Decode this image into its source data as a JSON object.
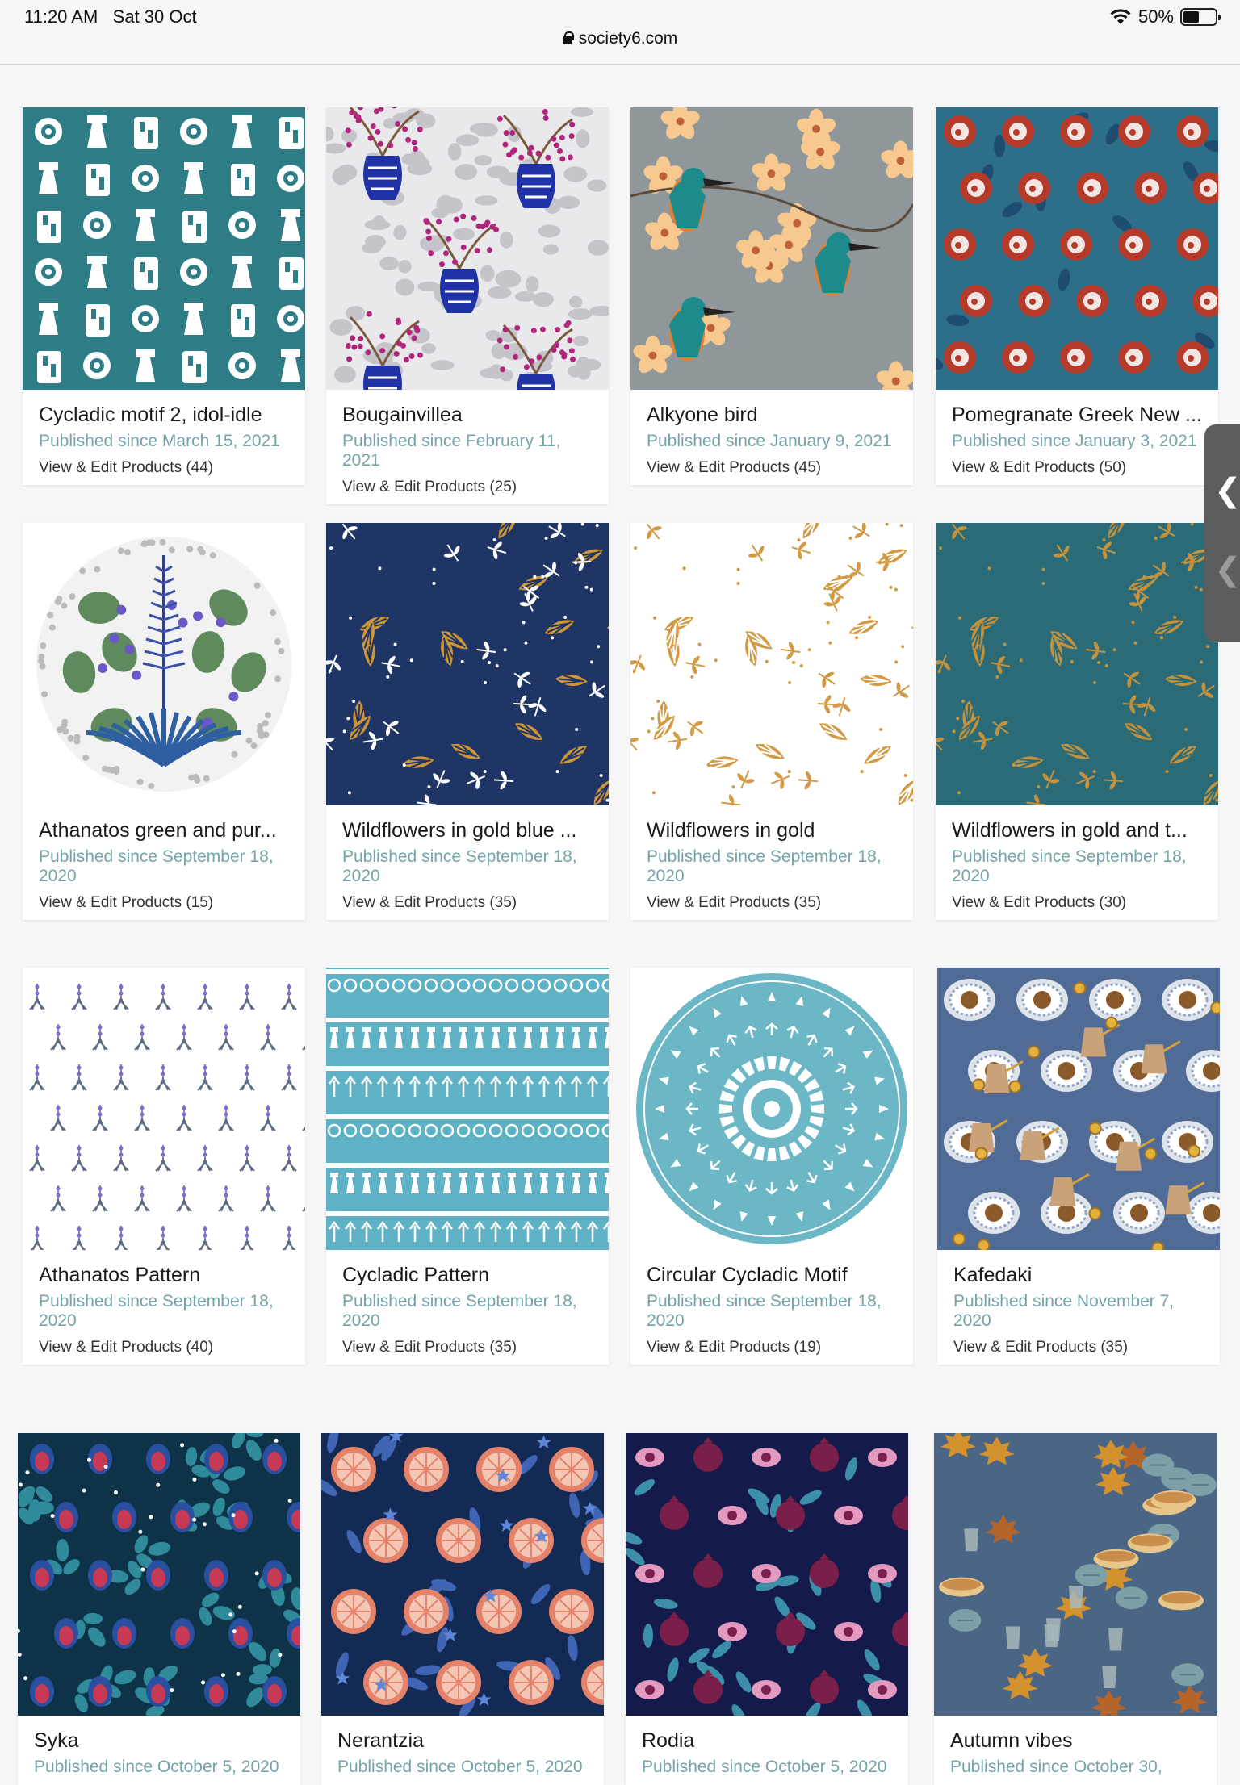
{
  "status": {
    "time": "11:20 AM",
    "date": "Sat 30 Oct",
    "battery": "50%",
    "battery_level": 0.5
  },
  "browser": {
    "url": "society6.com"
  },
  "colors": {
    "published": "#74a4a8"
  },
  "cards": [
    {
      "title": "Cycladic motif 2, idol-idle",
      "published": "Published since March 15, 2021",
      "edit": "View & Edit Products (44)",
      "art": "idols-teal"
    },
    {
      "title": "Bougainvillea",
      "published": "Published since February 11, 2021",
      "edit": "View & Edit Products (25)",
      "art": "bougainvillea"
    },
    {
      "title": "Alkyone bird",
      "published": "Published since January 9, 2021",
      "edit": "View & Edit Products (45)",
      "art": "kingfisher"
    },
    {
      "title": "Pomegranate Greek New ...",
      "published": "Published since January 3, 2021",
      "edit": "View & Edit Products (50)",
      "art": "pomegranate-teal"
    },
    {
      "title": "Athanatos green and pur...",
      "published": "Published since September 18, 2020",
      "edit": "View & Edit Products (15)",
      "art": "agave-circle"
    },
    {
      "title": "Wildflowers in gold blue ...",
      "published": "Published since September 18, 2020",
      "edit": "View & Edit Products (35)",
      "art": "wildflowers-navy"
    },
    {
      "title": "Wildflowers in gold",
      "published": "Published since September 18, 2020",
      "edit": "View & Edit Products (35)",
      "art": "wildflowers-white"
    },
    {
      "title": "Wildflowers in gold and t...",
      "published": "Published since September 18, 2020",
      "edit": "View & Edit Products (30)",
      "art": "wildflowers-teal"
    },
    {
      "title": "Athanatos Pattern",
      "published": "Published since September 18, 2020",
      "edit": "View & Edit Products (40)",
      "art": "agave-pattern"
    },
    {
      "title": "Cycladic Pattern",
      "published": "Published since September 18, 2020",
      "edit": "View & Edit Products (35)",
      "art": "cycladic-stripes"
    },
    {
      "title": "Circular Cycladic Motif",
      "published": "Published since September 18, 2020",
      "edit": "View & Edit Products (19)",
      "art": "cycladic-circle"
    },
    {
      "title": "Kafedaki",
      "published": "Published since November 7, 2020",
      "edit": "View & Edit Products (35)",
      "art": "coffee"
    },
    {
      "title": "Syka",
      "published": "Published since October 5, 2020",
      "edit": "",
      "art": "figs"
    },
    {
      "title": "Nerantzia",
      "published": "Published since October 5, 2020",
      "edit": "",
      "art": "oranges"
    },
    {
      "title": "Rodia",
      "published": "Published since October 5, 2020",
      "edit": "",
      "art": "pomegranate-navy"
    },
    {
      "title": "Autumn vibes",
      "published": "Published since October 30,",
      "edit": "",
      "art": "autumn"
    }
  ]
}
